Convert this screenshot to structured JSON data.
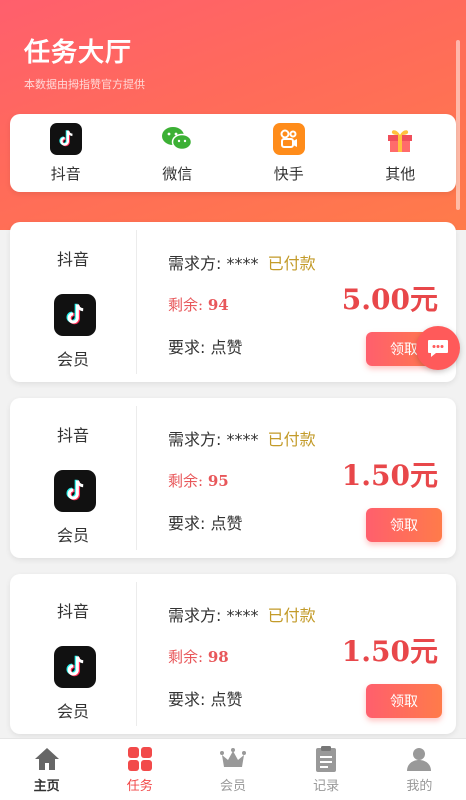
{
  "header": {
    "title": "任务大厅",
    "subtitle": "本数据由拇指赞官方提供"
  },
  "categories": [
    {
      "label": "抖音",
      "icon": "douyin-icon"
    },
    {
      "label": "微信",
      "icon": "wechat-icon"
    },
    {
      "label": "快手",
      "icon": "kuaishou-icon"
    },
    {
      "label": "其他",
      "icon": "gift-icon"
    }
  ],
  "tasks": [
    {
      "platform": "抖音",
      "member": "会员",
      "demander_label": "需求方:",
      "demander": "****",
      "paid": "已付款",
      "remaining_label": "剩余:",
      "remaining": "94",
      "price": "5.00元",
      "requirement_label": "要求:",
      "requirement": "点赞",
      "claim": "领取"
    },
    {
      "platform": "抖音",
      "member": "会员",
      "demander_label": "需求方:",
      "demander": "****",
      "paid": "已付款",
      "remaining_label": "剩余:",
      "remaining": "95",
      "price": "1.50元",
      "requirement_label": "要求:",
      "requirement": "点赞",
      "claim": "领取"
    },
    {
      "platform": "抖音",
      "member": "会员",
      "demander_label": "需求方:",
      "demander": "****",
      "paid": "已付款",
      "remaining_label": "剩余:",
      "remaining": "98",
      "price": "1.50元",
      "requirement_label": "要求:",
      "requirement": "点赞",
      "claim": "领取"
    }
  ],
  "tabbar": [
    {
      "label": "主页",
      "icon": "home-icon"
    },
    {
      "label": "任务",
      "icon": "tasks-grid-icon",
      "active": true
    },
    {
      "label": "会员",
      "icon": "crown-icon"
    },
    {
      "label": "记录",
      "icon": "clipboard-icon"
    },
    {
      "label": "我的",
      "icon": "user-icon"
    }
  ],
  "colors": {
    "accent": "#ff5f6d",
    "price": "#e8474a",
    "paid": "#c39b2a",
    "active_tab": "#f24a4a"
  }
}
